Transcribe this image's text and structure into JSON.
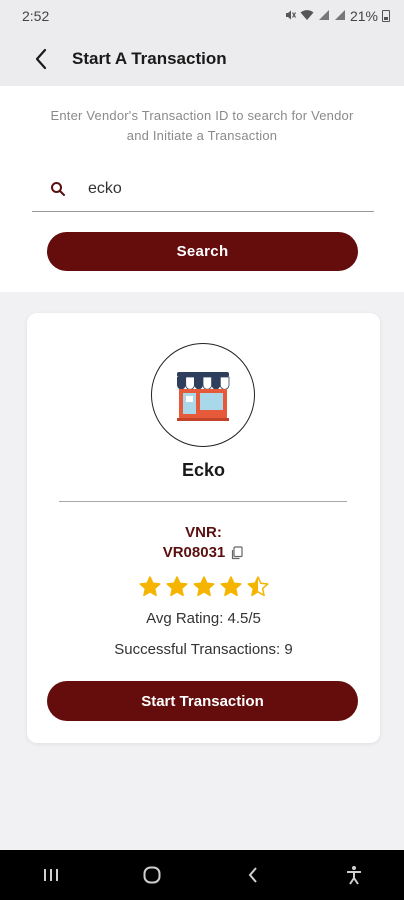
{
  "status_bar": {
    "time": "2:52",
    "battery": "21%",
    "icons": [
      "mute-icon",
      "wifi-icon",
      "signal-icon",
      "signal-icon",
      "battery-icon"
    ]
  },
  "app_bar": {
    "title": "Start A Transaction",
    "back_icon": "back-arrow-icon"
  },
  "search": {
    "instructions": "Enter Vendor's Transaction ID to search for Vendor and Initiate a Transaction",
    "input_value": "ecko",
    "button_label": "Search",
    "icon": "search-icon"
  },
  "vendor": {
    "name": "Ecko",
    "vnr_label": "VNR:",
    "vnr_value": "VR08031",
    "rating": 4.5,
    "rating_max": 5,
    "avg_rating_text": "Avg Rating: 4.5/5",
    "successful_text": "Successful Transactions: 9",
    "start_button_label": "Start Transaction",
    "avatar_icon": "storefront-icon",
    "copy_icon": "copy-icon"
  },
  "colors": {
    "primary": "#650c0c",
    "star": "#f5b400",
    "vnr_text": "#5a1010"
  },
  "nav_bar": {
    "icons": [
      "recent-apps-icon",
      "home-icon",
      "back-icon",
      "accessibility-icon"
    ]
  }
}
